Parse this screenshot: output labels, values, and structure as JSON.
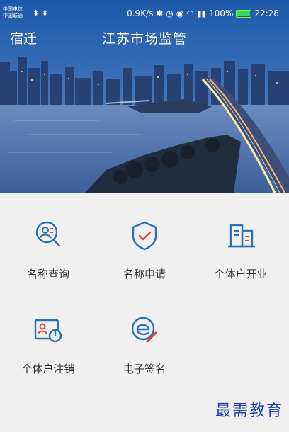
{
  "status_bar": {
    "carrier_1": "中国电信",
    "carrier_2": "中国联通",
    "usb_icons": "⬍ ⬍",
    "speed": "0.9K/s",
    "battery_percent": "100%",
    "time": "22:28"
  },
  "header": {
    "city": "宿迁",
    "title": "江苏市场监管"
  },
  "services": [
    {
      "label": "名称查询",
      "icon": "name-search-icon"
    },
    {
      "label": "名称申请",
      "icon": "shield-check-icon"
    },
    {
      "label": "个体户开业",
      "icon": "building-icon"
    },
    {
      "label": "个体户注销",
      "icon": "id-card-power-icon"
    },
    {
      "label": "电子签名",
      "icon": "e-signature-icon"
    }
  ],
  "watermark": "最需教育",
  "colors": {
    "icon_accent": "#2f6fb8",
    "icon_red": "#e0453a",
    "sky_top": "#1c4f9c",
    "water": "#5b7fb6"
  }
}
